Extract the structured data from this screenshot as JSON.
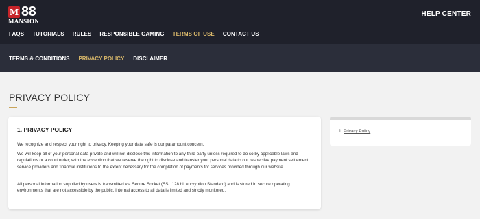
{
  "brand": {
    "logo_mark": "M",
    "logo_number": "88",
    "logo_subtext": "MANSION"
  },
  "header": {
    "help_center": "HELP CENTER"
  },
  "main_nav": [
    {
      "label": "FAQS"
    },
    {
      "label": "TUTORIALS"
    },
    {
      "label": "RULES"
    },
    {
      "label": "RESPONSIBLE GAMING"
    },
    {
      "label": "TERMS OF USE"
    },
    {
      "label": "CONTACT US"
    }
  ],
  "sub_nav": [
    {
      "label": "TERMS & CONDITIONS"
    },
    {
      "label": "PRIVACY POLICY"
    },
    {
      "label": "DISCLAIMER"
    }
  ],
  "page": {
    "title": "PRIVACY POLICY"
  },
  "content": {
    "heading": "1. PRIVACY POLICY",
    "paragraphs": [
      "We recognize and respect your right to privacy. Keeping your data safe is our paramount concern.",
      "We will keep all of your personal data private and will not disclose this information to any third party unless required to do so by applicable laws and regulations or a court order; with the exception that we reserve the right to disclose and transfer your personal data to our respective payment settlement service providers and financial institutions to the extent necessary for the completion of payments for services provided through our website.",
      "All personal information supplied by users is transmitted via Secure Socket (SSL 128 bit encryption Standard) and is stored in secure operating environments that are not accessible by the public. Internal access to all data is limited and strictly monitored."
    ]
  },
  "toc": {
    "prefix": "1. ",
    "link": "Privacy Policy"
  },
  "colors": {
    "header_bg": "#1f212b",
    "subheader_bg": "#2b2e3a",
    "accent_gold": "#d8b76a",
    "logo_red": "#c7242a",
    "page_bg": "#f2f2f2"
  }
}
